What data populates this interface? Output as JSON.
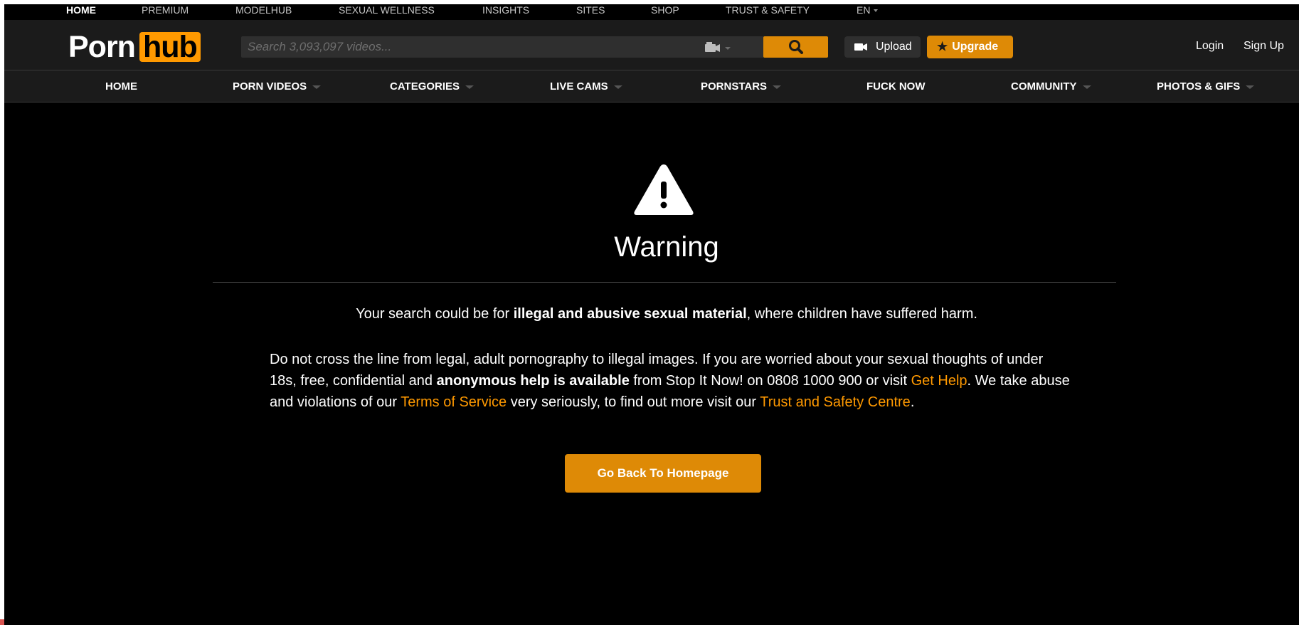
{
  "top_links": [
    {
      "label": "HOME",
      "active": true
    },
    {
      "label": "PREMIUM"
    },
    {
      "label": "MODELHUB"
    },
    {
      "label": "SEXUAL WELLNESS"
    },
    {
      "label": "INSIGHTS"
    },
    {
      "label": "SITES"
    },
    {
      "label": "SHOP"
    },
    {
      "label": "TRUST & SAFETY"
    },
    {
      "label": "EN"
    }
  ],
  "header": {
    "logo_part1": "Porn",
    "logo_part2": "hub",
    "search_placeholder": "Search 3,093,097 videos...",
    "upload_label": "Upload",
    "upgrade_label": "Upgrade",
    "login_label": "Login",
    "signup_label": "Sign Up",
    "icons": {
      "search": "search-icon",
      "camera": "video-camera-icon",
      "upload": "camera-icon",
      "upgrade": "star-icon"
    }
  },
  "nav": [
    {
      "label": "HOME"
    },
    {
      "label": "PORN VIDEOS",
      "dropdown": true
    },
    {
      "label": "CATEGORIES",
      "dropdown": true
    },
    {
      "label": "LIVE CAMS",
      "dropdown": true
    },
    {
      "label": "PORNSTARS",
      "dropdown": true
    },
    {
      "label": "FUCK NOW"
    },
    {
      "label": "COMMUNITY",
      "dropdown": true
    },
    {
      "label": "PHOTOS & GIFS",
      "dropdown": true
    }
  ],
  "warning": {
    "icon": "warning-triangle-icon",
    "title": "Warning",
    "msg1_pre": "Your search could be for ",
    "msg1_bold": "illegal and abusive sexual material",
    "msg1_post": ", where children have suffered harm.",
    "msg2_a": "Do not cross the line from legal, adult pornography to illegal images. If you are worried about your sexual thoughts of under 18s, free, confidential and ",
    "msg2_bold": "anonymous help is available",
    "msg2_b": " from Stop It Now! on 0808 1000 900 or visit ",
    "link_get_help": "Get Help",
    "msg2_c": ". We take abuse and violations of our ",
    "link_tos": "Terms of Service",
    "msg2_d": " very seriously, to find out more visit our ",
    "link_trust": "Trust and Safety Centre",
    "msg2_e": ".",
    "button_label": "Go Back To Homepage"
  },
  "colors": {
    "accent": "#ff9900",
    "button": "#de8a06",
    "header_bg": "#1b1b1b",
    "page_bg": "#000000"
  }
}
